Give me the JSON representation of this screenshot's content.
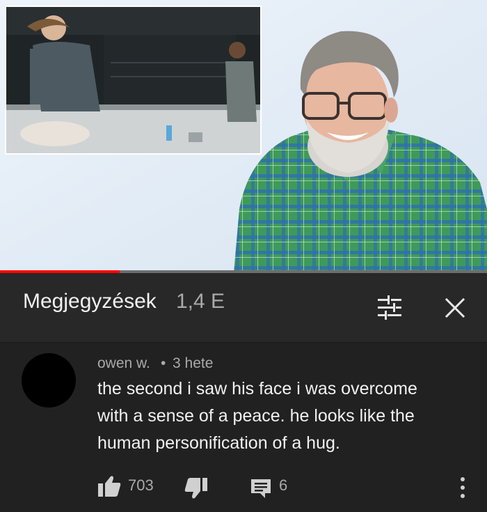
{
  "video": {
    "progress_fraction": 0.245
  },
  "comments_header": {
    "title": "Megjegyzések",
    "count": "1,4 E",
    "sort_icon": "sort-filter-icon",
    "close_icon": "close-icon"
  },
  "comment": {
    "author": "owen w.",
    "separator": "•",
    "time": "3 hete",
    "lines": [
      "the second i saw his face i was overcome",
      "with a sense of a peace. he looks like the",
      "human personification of a hug."
    ],
    "likes": "703",
    "replies": "6",
    "icons": {
      "like": "thumbs-up-icon",
      "dislike": "thumbs-down-icon",
      "reply": "reply-icon",
      "more": "more-vert-icon"
    }
  },
  "colors": {
    "background": "#212121",
    "header_background": "#282828",
    "primary_text": "#f1f1f1",
    "secondary_text": "#aaaaaa",
    "progress": "#ff0000",
    "video_background": "#e3edf7"
  }
}
